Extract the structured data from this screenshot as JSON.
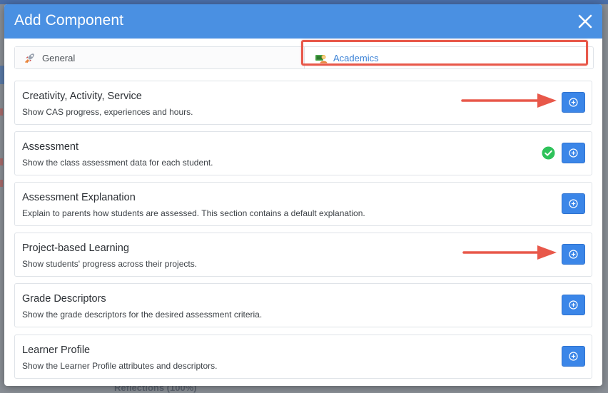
{
  "modal": {
    "title": "Add Component",
    "close_icon": "close-icon"
  },
  "tabs": [
    {
      "label": "General",
      "icon": "rocket-icon",
      "active": false
    },
    {
      "label": "Academics",
      "icon": "academics-icon",
      "active": true
    }
  ],
  "components": [
    {
      "title": "Creativity, Activity, Service",
      "description": "Show CAS progress, experiences and hours.",
      "added": false
    },
    {
      "title": "Assessment",
      "description": "Show the class assessment data for each student.",
      "added": true
    },
    {
      "title": "Assessment Explanation",
      "description": "Explain to parents how students are assessed. This section contains a default explanation.",
      "added": false
    },
    {
      "title": "Project-based Learning",
      "description": "Show students' progress across their projects.",
      "added": false
    },
    {
      "title": "Grade Descriptors",
      "description": "Show the grade descriptors for the desired assessment criteria.",
      "added": false
    },
    {
      "title": "Learner Profile",
      "description": "Show the Learner Profile attributes and descriptors.",
      "added": false
    }
  ],
  "background": {
    "peek_text": "Reflections (100%)"
  },
  "colors": {
    "header": "#4a90e2",
    "button": "#3b86e8",
    "highlight": "#e8584a",
    "check": "#2ec25a"
  }
}
